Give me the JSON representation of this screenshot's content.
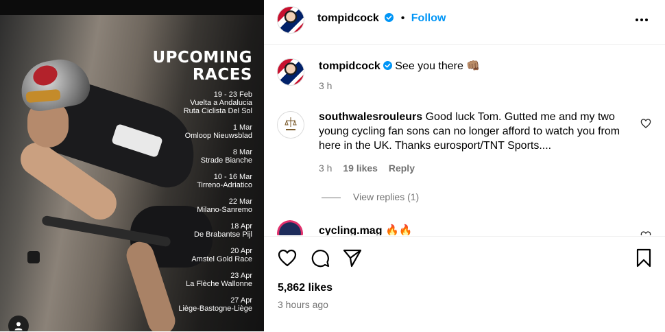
{
  "media": {
    "headline_line1": "UPCOMING",
    "headline_line2": "RACES",
    "races": [
      {
        "date": "19 - 23 Feb",
        "name": "Vuelta a Andalucia",
        "name2": "Ruta Ciclista Del Sol"
      },
      {
        "date": "1 Mar",
        "name": "Omloop Nieuwsblad",
        "name2": ""
      },
      {
        "date": "8 Mar",
        "name": "Strade Bianche",
        "name2": ""
      },
      {
        "date": "10 - 16 Mar",
        "name": "Tirreno-Adriatico",
        "name2": ""
      },
      {
        "date": "22 Mar",
        "name": "Milano-Sanremo",
        "name2": ""
      },
      {
        "date": "18 Apr",
        "name": "De Brabantse Pijl",
        "name2": ""
      },
      {
        "date": "20 Apr",
        "name": "Amstel Gold Race",
        "name2": ""
      },
      {
        "date": "23 Apr",
        "name": "La Flèche Wallonne",
        "name2": ""
      },
      {
        "date": "27 Apr",
        "name": "Liège-Bastogne-Liège",
        "name2": ""
      }
    ]
  },
  "header": {
    "username": "tompidcock",
    "separator": "•",
    "follow_label": "Follow"
  },
  "caption": {
    "username": "tompidcock",
    "text": "See you there",
    "emoji": "👊🏽",
    "time": "3 h"
  },
  "comments": [
    {
      "username": "southwalesrouleurs",
      "text": "Good luck Tom. Gutted me and my two young cycling fan sons can no longer afford to watch you from here in the UK. Thanks eurosport/TNT Sports....",
      "time": "3 h",
      "likes": "19 likes",
      "reply_label": "Reply",
      "view_replies": "View replies (1)"
    },
    {
      "username": "cycling.mag",
      "text": "🔥🔥"
    }
  ],
  "post": {
    "likes": "5,862 likes",
    "time_ago": "3 hours ago"
  },
  "colors": {
    "accent": "#0095f6",
    "secondary_text": "#737373",
    "divider": "#efefef"
  },
  "icons": [
    "verified-badge-icon",
    "more-options-icon",
    "heart-icon",
    "comment-icon",
    "share-icon",
    "bookmark-icon",
    "user-tag-icon"
  ]
}
